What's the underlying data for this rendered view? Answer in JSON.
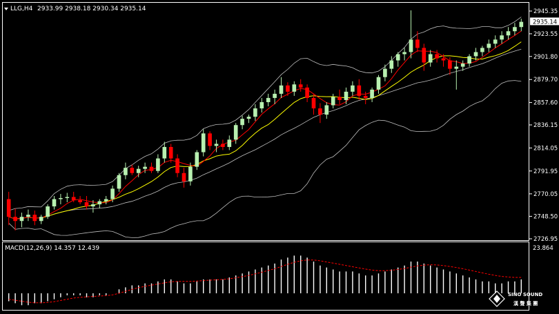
{
  "header": {
    "symbol": "LLG,H4",
    "ohlc": "2933.99 2938.18 2930.34 2935.14"
  },
  "macd_header": {
    "label": "MACD(12,26,9) 14.357 12.439"
  },
  "current_price": "2935.14",
  "colors": {
    "background": "#000000",
    "bull_candle": "#b8f0b0",
    "bear_candle": "#ff0000",
    "ma_fast": "#ff0000",
    "ma_slow": "#ffff00",
    "bands": "#c0c0c0",
    "macd_signal": "#ff0000",
    "grid_frame": "#ffffff"
  },
  "logo": {
    "text": "SINO SOUND",
    "subtext": "漢 聲 集 團",
    "icon": "diamond-logo-icon"
  },
  "chart_data": [
    {
      "type": "candlestick",
      "title": "LLG,H4",
      "ylim": [
        2726.95,
        2945.35
      ],
      "yticks": [
        "2945.35",
        "2923.55",
        "2901.80",
        "2879.70",
        "2857.60",
        "2836.15",
        "2814.05",
        "2791.95",
        "2770.05",
        "2748.50",
        "2726.95"
      ],
      "candles": [
        [
          2765,
          2772,
          2740,
          2748
        ],
        [
          2748,
          2756,
          2735,
          2744
        ],
        [
          2744,
          2752,
          2738,
          2748
        ],
        [
          2748,
          2755,
          2744,
          2750
        ],
        [
          2750,
          2754,
          2740,
          2744
        ],
        [
          2744,
          2750,
          2741,
          2748
        ],
        [
          2748,
          2760,
          2746,
          2758
        ],
        [
          2758,
          2768,
          2755,
          2765
        ],
        [
          2765,
          2770,
          2760,
          2766
        ],
        [
          2766,
          2771,
          2762,
          2767
        ],
        [
          2767,
          2772,
          2762,
          2764
        ],
        [
          2764,
          2768,
          2760,
          2762
        ],
        [
          2762,
          2768,
          2755,
          2758
        ],
        [
          2758,
          2764,
          2752,
          2760
        ],
        [
          2760,
          2765,
          2756,
          2763
        ],
        [
          2763,
          2768,
          2760,
          2765
        ],
        [
          2765,
          2778,
          2762,
          2775
        ],
        [
          2775,
          2790,
          2772,
          2788
        ],
        [
          2788,
          2800,
          2784,
          2795
        ],
        [
          2795,
          2798,
          2788,
          2790
        ],
        [
          2790,
          2797,
          2786,
          2794
        ],
        [
          2794,
          2800,
          2790,
          2796
        ],
        [
          2796,
          2800,
          2790,
          2792
        ],
        [
          2792,
          2808,
          2790,
          2804
        ],
        [
          2804,
          2820,
          2800,
          2815
        ],
        [
          2815,
          2818,
          2800,
          2804
        ],
        [
          2804,
          2808,
          2786,
          2790
        ],
        [
          2790,
          2795,
          2776,
          2782
        ],
        [
          2782,
          2800,
          2778,
          2796
        ],
        [
          2796,
          2812,
          2793,
          2810
        ],
        [
          2810,
          2832,
          2806,
          2828
        ],
        [
          2828,
          2830,
          2812,
          2816
        ],
        [
          2816,
          2822,
          2810,
          2818
        ],
        [
          2818,
          2822,
          2812,
          2815
        ],
        [
          2815,
          2826,
          2812,
          2822
        ],
        [
          2822,
          2838,
          2818,
          2836
        ],
        [
          2836,
          2845,
          2832,
          2842
        ],
        [
          2842,
          2846,
          2838,
          2844
        ],
        [
          2844,
          2856,
          2840,
          2852
        ],
        [
          2852,
          2862,
          2848,
          2858
        ],
        [
          2858,
          2866,
          2854,
          2862
        ],
        [
          2862,
          2870,
          2856,
          2866
        ],
        [
          2866,
          2882,
          2862,
          2874
        ],
        [
          2874,
          2877,
          2864,
          2868
        ],
        [
          2868,
          2878,
          2864,
          2875
        ],
        [
          2875,
          2880,
          2868,
          2872
        ],
        [
          2872,
          2875,
          2858,
          2862
        ],
        [
          2862,
          2866,
          2846,
          2852
        ],
        [
          2852,
          2857,
          2838,
          2846
        ],
        [
          2846,
          2858,
          2842,
          2855
        ],
        [
          2855,
          2866,
          2852,
          2863
        ],
        [
          2863,
          2870,
          2856,
          2860
        ],
        [
          2860,
          2872,
          2856,
          2868
        ],
        [
          2868,
          2878,
          2864,
          2874
        ],
        [
          2874,
          2880,
          2860,
          2864
        ],
        [
          2864,
          2868,
          2856,
          2862
        ],
        [
          2862,
          2872,
          2858,
          2870
        ],
        [
          2870,
          2884,
          2866,
          2882
        ],
        [
          2882,
          2894,
          2878,
          2890
        ],
        [
          2890,
          2902,
          2886,
          2898
        ],
        [
          2898,
          2906,
          2892,
          2904
        ],
        [
          2904,
          2910,
          2898,
          2906
        ],
        [
          2906,
          2946,
          2900,
          2918
        ],
        [
          2918,
          2926,
          2906,
          2910
        ],
        [
          2910,
          2914,
          2888,
          2896
        ],
        [
          2896,
          2908,
          2892,
          2904
        ],
        [
          2904,
          2908,
          2896,
          2900
        ],
        [
          2900,
          2904,
          2892,
          2898
        ],
        [
          2898,
          2901,
          2884,
          2890
        ],
        [
          2890,
          2898,
          2870,
          2892
        ],
        [
          2892,
          2898,
          2888,
          2895
        ],
        [
          2895,
          2904,
          2892,
          2902
        ],
        [
          2902,
          2910,
          2898,
          2906
        ],
        [
          2906,
          2912,
          2902,
          2910
        ],
        [
          2910,
          2918,
          2906,
          2914
        ],
        [
          2914,
          2922,
          2910,
          2918
        ],
        [
          2918,
          2926,
          2914,
          2922
        ],
        [
          2922,
          2930,
          2918,
          2926
        ],
        [
          2926,
          2934,
          2922,
          2930
        ],
        [
          2930,
          2938,
          2926,
          2935
        ]
      ],
      "macd": {
        "ylabel_top": "23.864",
        "histogram": [
          -4,
          -5,
          -6,
          -6,
          -5,
          -5,
          -4,
          -3,
          -2,
          -1,
          -1,
          -1,
          -2,
          -2,
          -1,
          -1,
          0,
          2,
          3,
          4,
          4,
          5,
          5,
          6,
          7,
          7,
          6,
          5,
          5,
          6,
          7,
          7,
          7,
          7,
          8,
          9,
          10,
          11,
          12,
          13,
          14,
          15,
          17,
          18,
          19,
          19,
          18,
          16,
          14,
          13,
          12,
          11,
          11,
          11,
          10,
          9,
          9,
          10,
          11,
          12,
          13,
          14,
          16,
          16,
          15,
          14,
          13,
          12,
          11,
          10,
          9,
          8,
          7,
          6,
          6,
          5,
          5,
          6,
          6,
          7
        ],
        "signal": [
          -3,
          -3.5,
          -4,
          -4.5,
          -4.8,
          -4.8,
          -4.6,
          -4.2,
          -3.6,
          -3,
          -2.4,
          -2,
          -1.8,
          -1.6,
          -1.4,
          -1.2,
          -0.8,
          0,
          1,
          2,
          2.8,
          3.5,
          4.1,
          4.7,
          5.3,
          5.8,
          6,
          6,
          6,
          6.2,
          6.4,
          6.6,
          6.8,
          7,
          7.3,
          7.8,
          8.4,
          9,
          9.8,
          10.6,
          11.5,
          12.4,
          13.5,
          14.6,
          15.6,
          16.4,
          16.8,
          16.8,
          16.4,
          15.8,
          15.2,
          14.6,
          14,
          13.4,
          12.8,
          12.2,
          11.7,
          11.4,
          11.4,
          11.6,
          12,
          12.5,
          13.2,
          13.8,
          14.2,
          14.4,
          14.3,
          14,
          13.5,
          13,
          12.4,
          11.7,
          11,
          10.3,
          9.6,
          9,
          8.5,
          8.2,
          8,
          8
        ]
      }
    }
  ]
}
